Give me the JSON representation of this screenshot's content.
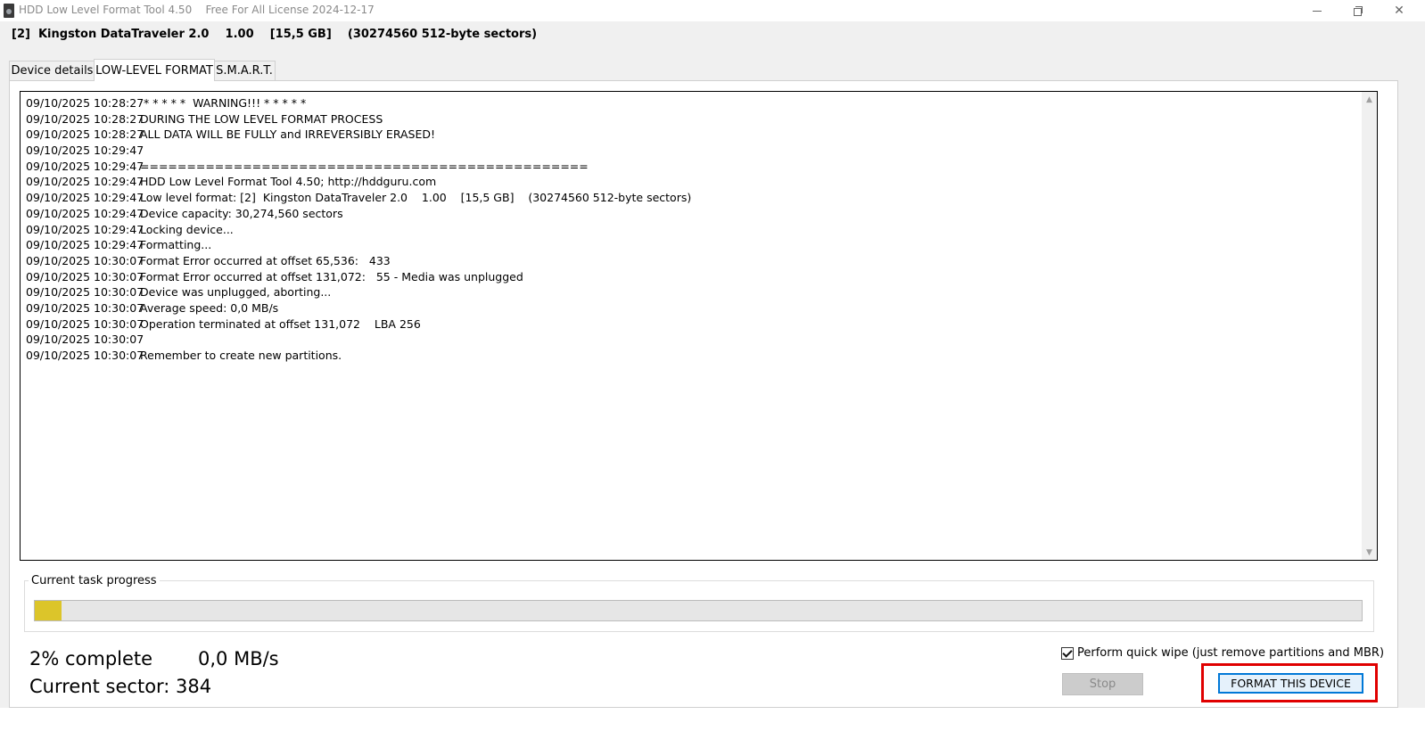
{
  "window": {
    "title": "HDD Low Level Format Tool 4.50    Free For All License 2024-12-17",
    "icon": "hard-drive-icon"
  },
  "device_header": "[2]  Kingston DataTraveler 2.0    1.00    [15,5 GB]    (30274560 512-byte sectors)",
  "tabs": [
    {
      "label": "Device details",
      "active": false
    },
    {
      "label": "LOW-LEVEL FORMAT",
      "active": true
    },
    {
      "label": "S.M.A.R.T.",
      "active": false
    }
  ],
  "log": [
    {
      "time": "09/10/2025 10:28:27",
      "msg": " * * * * *  WARNING!!! * * * * *"
    },
    {
      "time": "09/10/2025 10:28:27",
      "msg": "DURING THE LOW LEVEL FORMAT PROCESS"
    },
    {
      "time": "09/10/2025 10:28:27",
      "msg": "ALL DATA WILL BE FULLY and IRREVERSIBLY ERASED!"
    },
    {
      "time": "09/10/2025 10:29:47",
      "msg": ""
    },
    {
      "time": "09/10/2025 10:29:47",
      "msg": "================================================"
    },
    {
      "time": "09/10/2025 10:29:47",
      "msg": "HDD Low Level Format Tool 4.50; http://hddguru.com"
    },
    {
      "time": "09/10/2025 10:29:47",
      "msg": "Low level format: [2]  Kingston DataTraveler 2.0    1.00    [15,5 GB]    (30274560 512-byte sectors)"
    },
    {
      "time": "09/10/2025 10:29:47",
      "msg": "Device capacity: 30,274,560 sectors"
    },
    {
      "time": "09/10/2025 10:29:47",
      "msg": "Locking device..."
    },
    {
      "time": "09/10/2025 10:29:47",
      "msg": "Formatting..."
    },
    {
      "time": "09/10/2025 10:30:07",
      "msg": "Format Error occurred at offset 65,536:   433"
    },
    {
      "time": "09/10/2025 10:30:07",
      "msg": "Format Error occurred at offset 131,072:   55 - Media was unplugged"
    },
    {
      "time": "09/10/2025 10:30:07",
      "msg": "Device was unplugged, aborting..."
    },
    {
      "time": "09/10/2025 10:30:07",
      "msg": "Average speed: 0,0 MB/s"
    },
    {
      "time": "09/10/2025 10:30:07",
      "msg": "Operation terminated at offset 131,072    LBA 256"
    },
    {
      "time": "09/10/2025 10:30:07",
      "msg": ""
    },
    {
      "time": "09/10/2025 10:30:07",
      "msg": "Remember to create new partitions."
    }
  ],
  "progress": {
    "group_label": "Current task progress",
    "fraction": 0.02,
    "fill_color": "#dcc52a"
  },
  "stats": {
    "complete": "2% complete",
    "speed": "0,0 MB/s",
    "sector": "Current sector: 384"
  },
  "options": {
    "quick_wipe_label": "Perform quick wipe (just remove partitions and MBR)",
    "quick_wipe_checked": true
  },
  "buttons": {
    "stop": "Stop",
    "format": "FORMAT THIS DEVICE"
  },
  "colors": {
    "highlight": "#e00000",
    "accent": "#0078d7"
  }
}
